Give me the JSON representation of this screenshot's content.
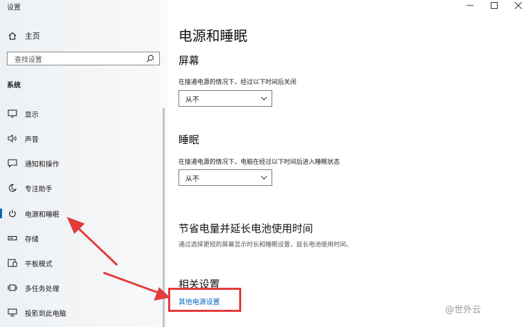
{
  "window": {
    "title": "设置",
    "controls": [
      "minimize",
      "maximize",
      "close"
    ]
  },
  "sidebar": {
    "home_label": "主页",
    "search_placeholder": "查找设置",
    "section_title": "系统",
    "items": [
      {
        "label": "显示",
        "icon": "display-icon"
      },
      {
        "label": "声音",
        "icon": "speaker-icon"
      },
      {
        "label": "通知和操作",
        "icon": "notification-icon"
      },
      {
        "label": "专注助手",
        "icon": "moon-icon"
      },
      {
        "label": "电源和睡眠",
        "icon": "power-icon",
        "active": true
      },
      {
        "label": "存储",
        "icon": "storage-icon"
      },
      {
        "label": "平板模式",
        "icon": "tablet-icon"
      },
      {
        "label": "多任务处理",
        "icon": "multitask-icon"
      },
      {
        "label": "投影到此电脑",
        "icon": "projector-icon"
      }
    ]
  },
  "main": {
    "title": "电源和睡眠",
    "screen": {
      "heading": "屏幕",
      "description": "在接通电源的情况下，经过以下时间后关闭",
      "value": "从不"
    },
    "sleep": {
      "heading": "睡眠",
      "description": "在接通电源的情况下，电脑在经过以下时间后进入睡眠状态",
      "value": "从不"
    },
    "battery": {
      "heading": "节省电量并延长电池使用时间",
      "description": "通过选择更短的屏幕显示时长和睡眠设置，延长电池使用时间。"
    },
    "related": {
      "heading": "相关设置",
      "link": "其他电源设置"
    }
  },
  "annotations": {
    "highlight_color": "#e43a3a",
    "accent_color": "#0067c0"
  },
  "watermark": "@世外云"
}
